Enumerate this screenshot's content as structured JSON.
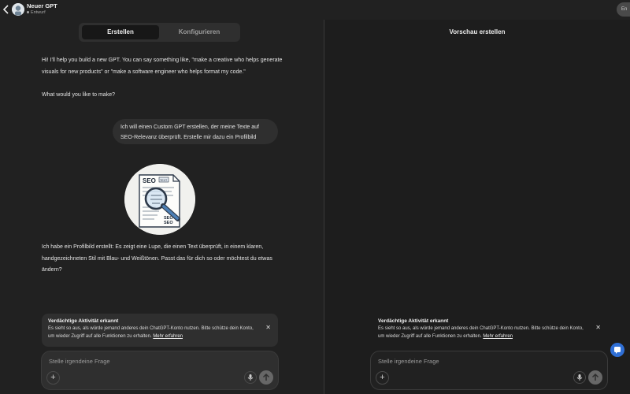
{
  "header": {
    "title": "Neuer GPT",
    "status": "Entwurf",
    "right_button": "En",
    "back_icon": "chevron-left-icon"
  },
  "tabs": [
    {
      "label": "Erstellen",
      "active": true
    },
    {
      "label": "Konfigurieren",
      "active": false
    }
  ],
  "chat": {
    "assistant_intro_1": "Hi! I'll help you build a new GPT. You can say something like, \"make a creative who helps generate visuals for new products\" or \"make a software engineer who helps format my code.\"",
    "assistant_intro_2": "What would you like to make?",
    "user_message": "Ich will einen Custom GPT erstellen, der meine Texte auf SEO-Relevanz überprüft. Erstelle mir dazu ein Profilbild",
    "profile_image_text": {
      "top": "SEO",
      "tag": "TEXT",
      "bottom_1": "SEO",
      "bottom_2": "SEO"
    },
    "assistant_reply": "Ich habe ein Profilbild erstellt: Es zeigt eine Lupe, die einen Text überprüft, in einem klaren, handgezeichneten Stil mit Blau- und Weißtönen. Passt das für dich so oder möchtest du etwas ändern?"
  },
  "alert": {
    "title": "Verdächtige Aktivität erkannt",
    "body": "Es sieht so aus, als würde jemand anderes dein ChatGPT-Konto nutzen. Bitte schütze dein Konto, um wieder Zugriff auf alle Funktionen zu erhalten.",
    "link": "Mehr erfahren",
    "close_icon": "close-icon"
  },
  "composer": {
    "placeholder": "Stelle irgendeine Frage",
    "plus_icon": "plus-icon",
    "mic_icon": "microphone-icon",
    "send_icon": "arrow-up-icon"
  },
  "preview": {
    "title": "Vorschau erstellen"
  },
  "colors": {
    "background": "#212121",
    "panel": "#2f2f2f",
    "accent_blue": "#2f6fd6"
  }
}
